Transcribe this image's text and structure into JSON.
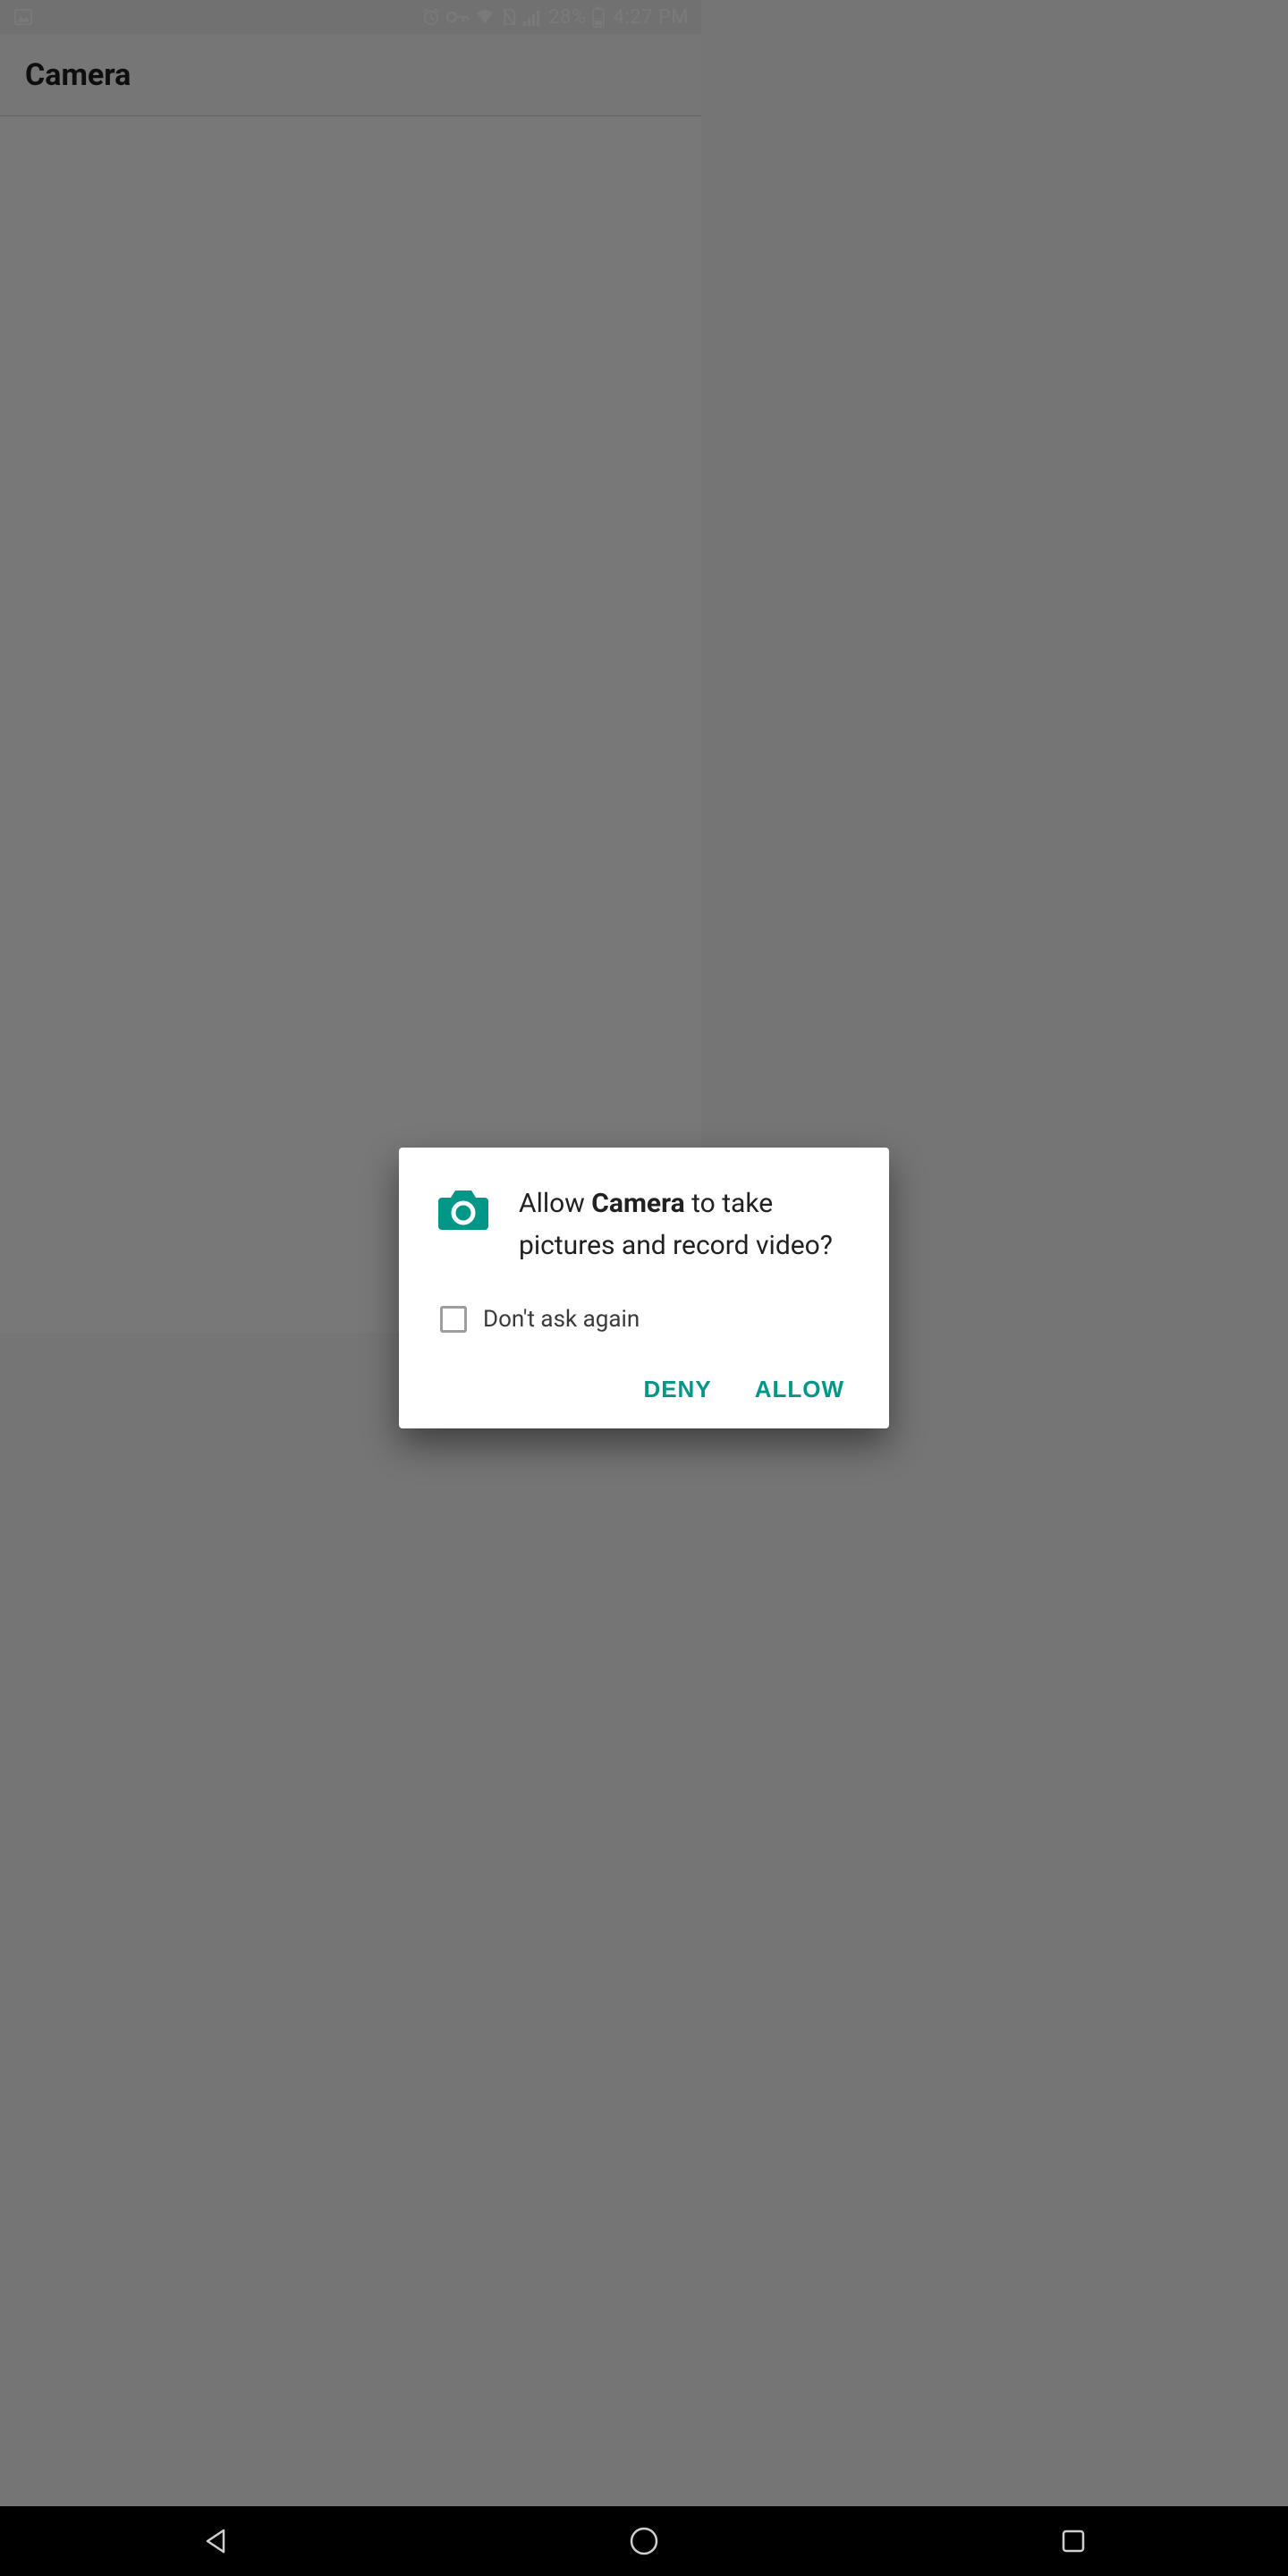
{
  "status_bar": {
    "battery_pct": "28%",
    "time": "4:27 PM"
  },
  "app_bar": {
    "title": "Camera"
  },
  "dialog": {
    "message_pre": "Allow ",
    "message_app": "Camera",
    "message_post": " to take pictures and record video?",
    "dont_ask_label": "Don't ask again",
    "deny_label": "DENY",
    "allow_label": "ALLOW",
    "accent_color": "#009688"
  }
}
